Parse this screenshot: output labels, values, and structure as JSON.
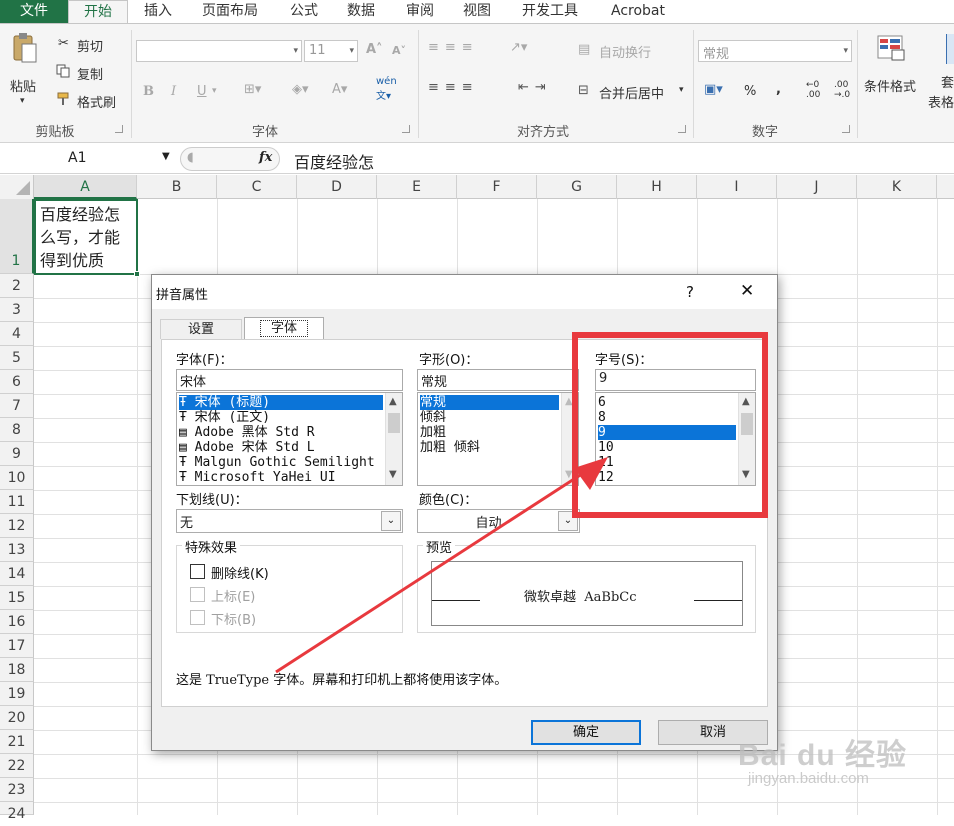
{
  "ribbon_tabs": [
    "文件",
    "开始",
    "插入",
    "页面布局",
    "公式",
    "数据",
    "审阅",
    "视图",
    "开发工具",
    "Acrobat"
  ],
  "clipboard": {
    "paste": "粘贴",
    "cut": "剪切",
    "copy": "复制",
    "format_painter": "格式刷",
    "group": "剪贴板"
  },
  "font_group": {
    "font_size": "11",
    "group": "字体",
    "bold": "B",
    "italic": "I",
    "underline": "U"
  },
  "align_group": {
    "wrap": "自动换行",
    "merge": "合并后居中",
    "group": "对齐方式"
  },
  "number_group": {
    "format": "常规",
    "percent": "%",
    "comma": ",",
    "group": "数字"
  },
  "styles": {
    "cond_format": "条件格式",
    "table_format": "套\n表格"
  },
  "formula_bar": {
    "name_box": "A1",
    "fx": "fx",
    "content": "百度经验怎"
  },
  "columns": [
    "A",
    "B",
    "C",
    "D",
    "E",
    "F",
    "G",
    "H",
    "I",
    "J",
    "K"
  ],
  "rows": [
    "1",
    "2",
    "3",
    "4",
    "5",
    "6",
    "7",
    "8",
    "9",
    "10",
    "11",
    "12",
    "13",
    "14",
    "15",
    "16",
    "17",
    "18",
    "19",
    "20",
    "21",
    "22",
    "23",
    "24"
  ],
  "cell_a1": [
    "百度经验怎",
    "么写，才能",
    "得到优质"
  ],
  "dialog": {
    "title": "拼音属性",
    "help": "?",
    "close": "✕",
    "tabs": [
      "设置",
      "字体"
    ],
    "font_label": "字体(F)：",
    "font_value": "宋体",
    "font_list": [
      "宋体 (标题)",
      "宋体 (正文)",
      "Adobe 黑体 Std R",
      "Adobe 宋体 Std L",
      "Malgun Gothic Semilight",
      "Microsoft YaHei UI"
    ],
    "style_label": "字形(O)：",
    "style_value": "常规",
    "style_list": [
      "常规",
      "倾斜",
      "加粗",
      "加粗 倾斜"
    ],
    "size_label": "字号(S)：",
    "size_value": "9",
    "size_list": [
      "6",
      "8",
      "9",
      "10",
      "11",
      "12"
    ],
    "underline_label": "下划线(U)：",
    "underline_value": "无",
    "color_label": "颜色(C)：",
    "color_value": "自动",
    "effects_label": "特殊效果",
    "strike": "删除线(K)",
    "superscript": "上标(E)",
    "subscript": "下标(B)",
    "preview_label": "预览",
    "preview_text": "微软卓越  AaBbCc",
    "info": "这是 TrueType 字体。屏幕和打印机上都将使用该字体。",
    "ok": "确定",
    "cancel": "取消"
  },
  "watermark": {
    "brand": "Bai du 经验",
    "url": "jingyan.baidu.com"
  },
  "colors": {
    "excel_green": "#217346",
    "selection": "#0b74d8",
    "highlight": "#e8393e"
  }
}
